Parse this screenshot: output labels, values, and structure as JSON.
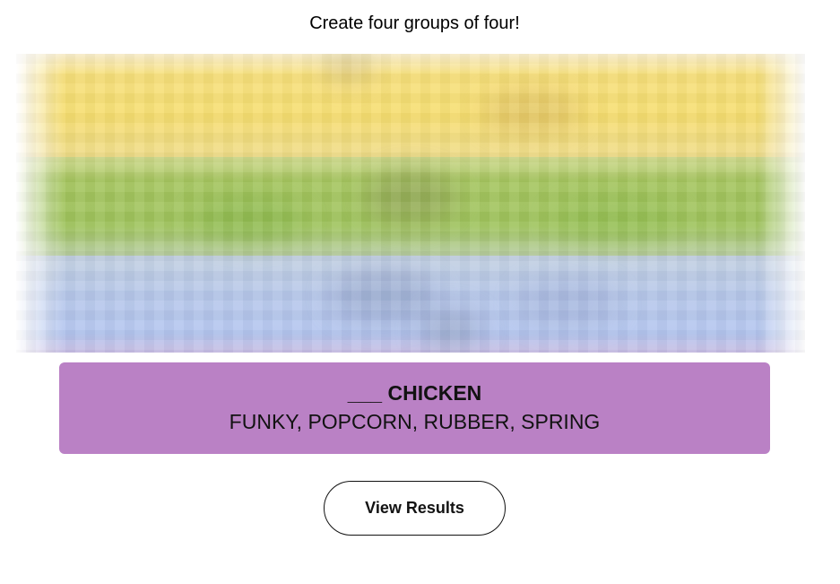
{
  "header": {
    "instructions": "Create four groups of four!"
  },
  "hidden_groups": [
    {
      "color": "#f6dd6f",
      "state": "blurred"
    },
    {
      "color": "#a0c35a",
      "state": "blurred"
    },
    {
      "color": "#b0c4ef",
      "state": "blurred"
    }
  ],
  "revealed_group": {
    "color": "#ba81c5",
    "title": "___ CHICKEN",
    "members": "FUNKY, POPCORN, RUBBER, SPRING"
  },
  "actions": {
    "view_results_label": "View Results"
  }
}
